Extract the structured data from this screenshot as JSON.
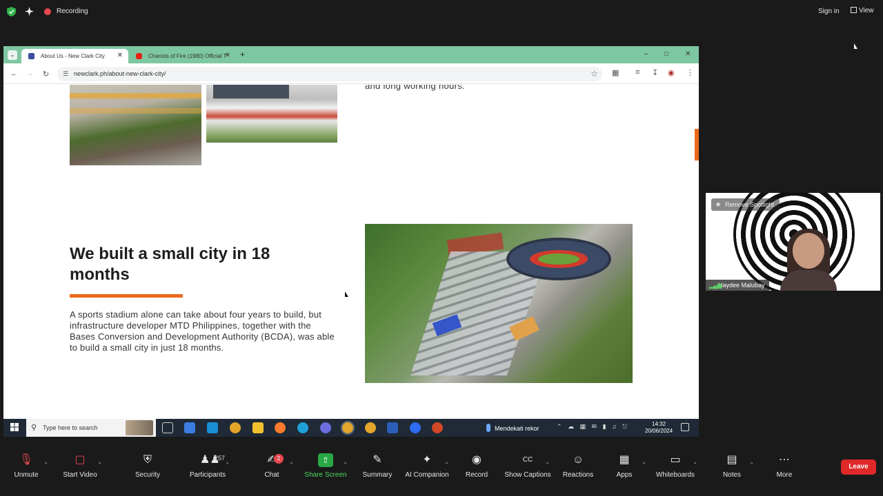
{
  "zoom_top": {
    "recording_label": "Recording",
    "sign_in_label": "Sign in",
    "view_label": "View"
  },
  "browser": {
    "tabs": [
      {
        "title": "About Us - New Clark City"
      },
      {
        "title": "Chariots of Fire (1980) Official T"
      }
    ],
    "address": "newclark.ph/about-new-clark-city/",
    "window_controls": [
      "–",
      "□",
      "✕"
    ]
  },
  "page": {
    "top_right_text": "and long working hours.",
    "headline": "We built a small city in 18 months",
    "paragraph": "A sports stadium alone can take about four years to build, but infrastructure developer MTD Philippines, together with the Bases Conversion and Development Authority (BCDA), was able to build a small city in just 18 months.",
    "accent_color": "#ea6a1c"
  },
  "taskbar": {
    "search_placeholder": "Type here to search",
    "weather_text": "Mendekati rekor",
    "time": "14:32",
    "date": "20/06/2024"
  },
  "video_tile": {
    "spotlight_label": "Remove Spotlight",
    "participant_name": "Haydee Malubay"
  },
  "zoom_bottom": {
    "unmute": "Unmute",
    "start_video": "Start Video",
    "security": "Security",
    "participants": "Participants",
    "participants_count": "257",
    "chat": "Chat",
    "chat_badge": "2",
    "share_screen": "Share Screen",
    "summary": "Summary",
    "ai_companion": "AI Companion",
    "record": "Record",
    "show_captions": "Show Captions",
    "reactions": "Reactions",
    "apps": "Apps",
    "whiteboards": "Whiteboards",
    "notes": "Notes",
    "more": "More",
    "leave": "Leave"
  }
}
